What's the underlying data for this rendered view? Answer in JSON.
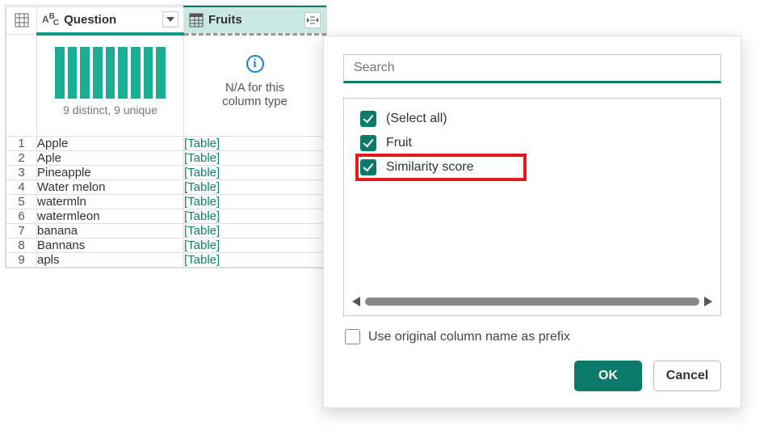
{
  "columns": {
    "question": {
      "label": "Question",
      "stat": "9 distinct, 9 unique"
    },
    "fruits": {
      "label": "Fruits",
      "na_line1": "N/A for this",
      "na_line2": "column type"
    }
  },
  "rows": [
    {
      "n": "1",
      "q": "Apple",
      "f": "[Table]"
    },
    {
      "n": "2",
      "q": "Aple",
      "f": "[Table]"
    },
    {
      "n": "3",
      "q": "Pineapple",
      "f": "[Table]"
    },
    {
      "n": "4",
      "q": "Water melon",
      "f": "[Table]"
    },
    {
      "n": "5",
      "q": "watermln",
      "f": "[Table]"
    },
    {
      "n": "6",
      "q": "watermleon",
      "f": "[Table]"
    },
    {
      "n": "7",
      "q": "banana",
      "f": "[Table]"
    },
    {
      "n": "8",
      "q": "Bannans",
      "f": "[Table]"
    },
    {
      "n": "9",
      "q": "apls",
      "f": "[Table]"
    }
  ],
  "popup": {
    "search_placeholder": "Search",
    "options": {
      "select_all": "(Select all)",
      "fruit": "Fruit",
      "similarity": "Similarity score"
    },
    "prefix_label": "Use original column name as prefix",
    "ok": "OK",
    "cancel": "Cancel"
  }
}
